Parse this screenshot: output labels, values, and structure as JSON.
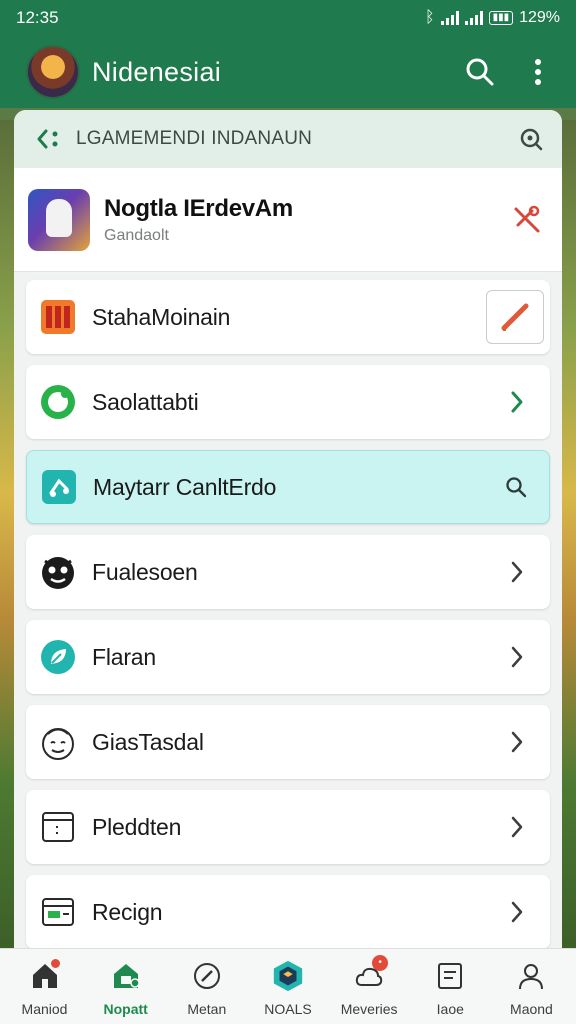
{
  "status_bar": {
    "time": "12:35",
    "battery": "129%"
  },
  "app_bar": {
    "title": "Nidenesiai",
    "search_icon": "search-icon",
    "menu_icon": "more-vert-icon"
  },
  "panel": {
    "header_title": "LGAMEMENDI INDANAUN",
    "featured": {
      "name": "Nogtla IErdevAm",
      "subtitle": "Gandaolt"
    }
  },
  "rows": [
    {
      "label": "StahaMoinain",
      "icon": "game-tile-icon",
      "trailing": "edit-icon",
      "active": false
    },
    {
      "label": "Saolattabti",
      "icon": "chat-bubble-icon",
      "trailing": "chevron-right-icon",
      "active": false
    },
    {
      "label": "Maytarr CanltErdo",
      "icon": "music-share-icon",
      "trailing": "search-icon",
      "active": true
    },
    {
      "label": "Fualesoen",
      "icon": "mask-face-icon",
      "trailing": "chevron-right-icon",
      "active": false
    },
    {
      "label": "Flaran",
      "icon": "leaf-icon",
      "trailing": "chevron-right-icon",
      "active": false
    },
    {
      "label": "GiasTasdal",
      "icon": "smiley-face-icon",
      "trailing": "chevron-right-icon",
      "active": false
    },
    {
      "label": "Pleddten",
      "icon": "document-icon",
      "trailing": "chevron-right-icon",
      "active": false
    },
    {
      "label": "Recign",
      "icon": "card-icon",
      "trailing": "chevron-right-icon",
      "active": false
    }
  ],
  "bottom_nav": [
    {
      "label": "Maniod",
      "icon": "home-icon"
    },
    {
      "label": "Nopatt",
      "icon": "store-icon",
      "active": true
    },
    {
      "label": "Metan",
      "icon": "compass-icon"
    },
    {
      "label": "NOALS",
      "icon": "game-cube-icon"
    },
    {
      "label": "Meveries",
      "icon": "cloud-badge-icon"
    },
    {
      "label": "Iaoe",
      "icon": "list-doc-icon"
    },
    {
      "label": "Maond",
      "icon": "person-icon"
    }
  ],
  "colors": {
    "primary": "#1f7a4e",
    "active_row": "#c9f4f1",
    "accent_red": "#e24a3a",
    "accent_teal": "#22b5b0"
  }
}
